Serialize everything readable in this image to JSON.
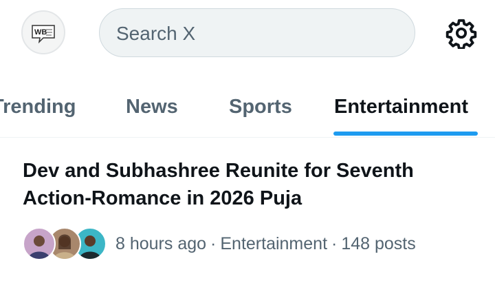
{
  "header": {
    "avatar_logo_text": "WB",
    "search_placeholder": "Search X",
    "settings_icon": "gear-icon"
  },
  "tabs": [
    {
      "label": "Trending",
      "active": false
    },
    {
      "label": "News",
      "active": false
    },
    {
      "label": "Sports",
      "active": false
    },
    {
      "label": "Entertainment",
      "active": true
    }
  ],
  "story": {
    "title": "Dev and Subhashree Reunite for Seventh Action-Romance in 2026 Puja",
    "time": "8 hours ago",
    "category": "Entertainment",
    "posts": "148 posts",
    "separator": "·"
  },
  "colors": {
    "accent": "#1d9bf0",
    "secondary_text": "#536471",
    "primary_text": "#0f1419"
  }
}
